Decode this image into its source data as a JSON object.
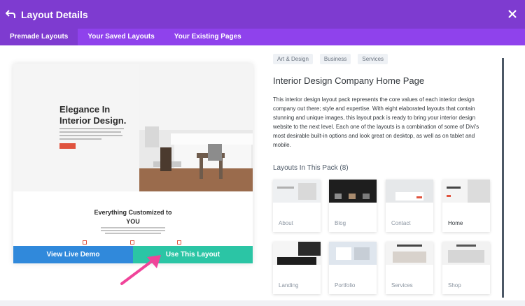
{
  "header": {
    "title": "Layout Details",
    "back_icon": "back-arrow-icon",
    "close_icon": "close-icon",
    "bg_color": "#7e3bd0"
  },
  "tabs": [
    {
      "label": "Premade Layouts",
      "active": true
    },
    {
      "label": "Your Saved Layouts",
      "active": false
    },
    {
      "label": "Your Existing Pages",
      "active": false
    }
  ],
  "preview": {
    "hero_title": "Elegance In\nInterior Design.",
    "section_title": "Everything Customized to\nYOU"
  },
  "actions": {
    "live_demo_label": "View Live Demo",
    "use_layout_label": "Use This Layout",
    "live_demo_color": "#3089db",
    "use_layout_color": "#2bc5a5"
  },
  "details": {
    "tags": [
      "Art & Design",
      "Business",
      "Services"
    ],
    "title": "Interior Design Company Home Page",
    "description": "This interior design layout pack represents the core values of each interior design company out there; style and expertise. With eight elaborated layouts that contain stunning and unique images, this layout pack is ready to bring your interior design website to the next level. Each one of the layouts is a combination of some of Divi's most desirable built-in options and look great on desktop, as well as on tablet and mobile.",
    "pack_title": "Layouts In This Pack (8)"
  },
  "layouts": [
    {
      "label": "About",
      "active": false
    },
    {
      "label": "Blog",
      "active": false
    },
    {
      "label": "Contact",
      "active": false
    },
    {
      "label": "Home",
      "active": true
    },
    {
      "label": "Landing",
      "active": false
    },
    {
      "label": "Portfolio",
      "active": false
    },
    {
      "label": "Services",
      "active": false
    },
    {
      "label": "Shop",
      "active": false
    }
  ]
}
